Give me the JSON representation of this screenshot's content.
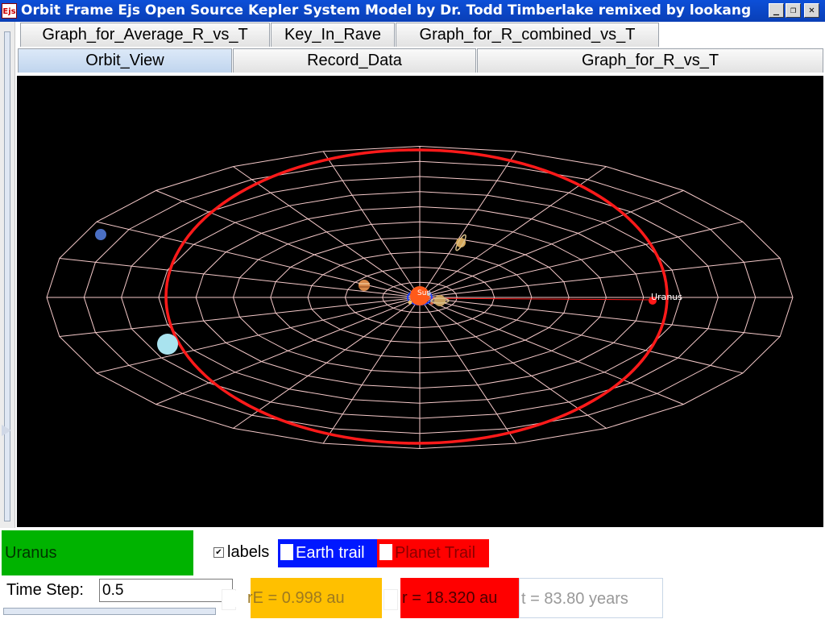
{
  "window": {
    "title": "Orbit Frame Ejs Open Source Kepler System Model by Dr. Todd Timberlake remixed by lookang",
    "app_icon": "Ejs",
    "buttons": {
      "minimize": "_",
      "restore": "❐",
      "close": "✕"
    }
  },
  "tabs_top": [
    {
      "label": "Graph_for_Average_R_vs_T"
    },
    {
      "label": "Key_In_Rave"
    },
    {
      "label": "Graph_for_R_combined_vs_T"
    }
  ],
  "tabs_bottom": [
    {
      "label": "Orbit_View",
      "active": true
    },
    {
      "label": "Record_Data"
    },
    {
      "label": "Graph_for_R_vs_T"
    }
  ],
  "scene": {
    "sun_label": "Sun",
    "planet_label": "Uranus",
    "colors": {
      "background": "#000000",
      "grid": "#f5c9c9",
      "orbit": "#ff1a1a"
    },
    "bodies": [
      "sun",
      "mercury",
      "venus",
      "earth",
      "mars",
      "jupiter",
      "saturn",
      "uranus",
      "neptune"
    ]
  },
  "controls": {
    "planet_select": "Uranus",
    "planet_select_color": "#00b300",
    "labels_checked": true,
    "labels_text": "labels",
    "earth_trail": "Earth trail",
    "earth_trail_color": "#0018ff",
    "planet_trail": "Planet Trail",
    "planet_trail_color": "#ff0000",
    "time_step_label": "Time Step:",
    "time_step_value": "0.5"
  },
  "readouts": {
    "rE": "rE = 0.998 au",
    "r": "r = 18.320 au",
    "t": "t = 83.80 years"
  }
}
